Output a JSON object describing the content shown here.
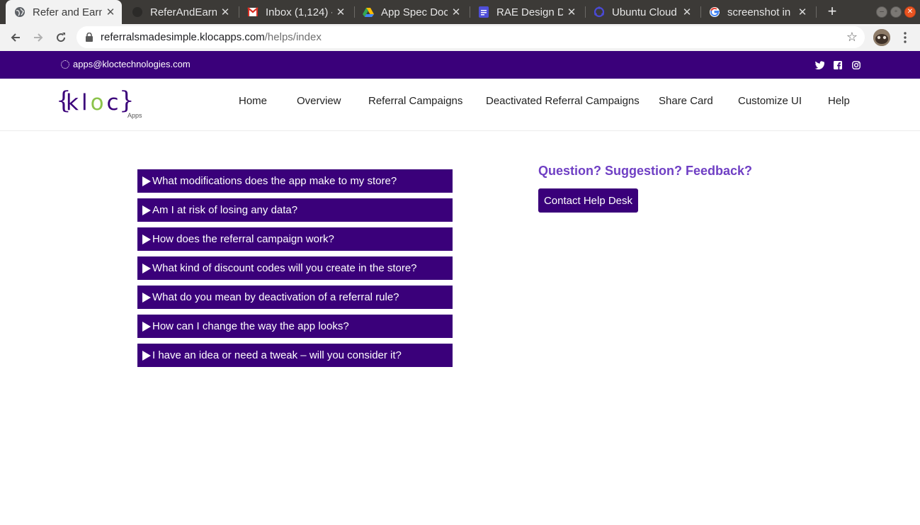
{
  "browser": {
    "tabs": [
      {
        "title": "Refer and Earn",
        "active": true,
        "icon": "globe-icon"
      },
      {
        "title": "ReferAndEarn",
        "active": false,
        "icon": "github-icon"
      },
      {
        "title": "Inbox (1,124) -",
        "active": false,
        "icon": "gmail-icon"
      },
      {
        "title": "App Spec Docs",
        "active": false,
        "icon": "google-drive-icon"
      },
      {
        "title": "RAE Design Do",
        "active": false,
        "icon": "google-docs-icon"
      },
      {
        "title": "Ubuntu Cloud",
        "active": false,
        "icon": "ubuntu-icon"
      },
      {
        "title": "screenshot in u",
        "active": false,
        "icon": "google-icon"
      }
    ],
    "address": {
      "host": "referralsmadesimple.klocapps.com",
      "path": "/helps/index"
    }
  },
  "topbar": {
    "email": "apps@kloctechnologies.com",
    "social": [
      "twitter-icon",
      "facebook-icon",
      "instagram-icon"
    ],
    "background": "#3a007a"
  },
  "logo": {
    "open_brace": "{",
    "text_k": "k",
    "text_l": "l",
    "text_o": "o",
    "text_c": "c",
    "close_brace": "}",
    "sub": "Apps"
  },
  "nav": {
    "items": [
      "Home",
      "Overview",
      "Referral Campaigns",
      "Deactivated Referral Campaigns",
      "Share Card",
      "Customize UI",
      "Help"
    ]
  },
  "faq": {
    "items": [
      "What modifications does the app make to my store?",
      "Am I at risk of losing any data?",
      "How does the referral campaign work?",
      "What kind of discount codes will you create in the store?",
      "What do you mean by deactivation of a referral rule?",
      "How can I change the way the app looks?",
      "I have an idea or need a tweak – will you consider it?"
    ]
  },
  "help": {
    "title": "Question? Suggestion? Feedback?",
    "button": "Contact Help Desk",
    "accent": "#6f3fc4"
  }
}
